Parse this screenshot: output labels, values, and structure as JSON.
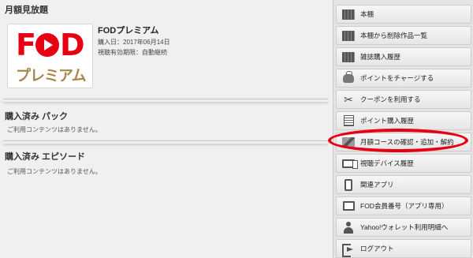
{
  "main": {
    "monthly_title": "月額見放題",
    "product": {
      "name": "FODプレミアム",
      "purchase_date": "購入日：2017年06月14日",
      "validity": "視聴有効期限：自動継続",
      "logo_text_top": "FOD",
      "logo_text_bottom": "プレミアム"
    },
    "pack_title": "購入済み パック",
    "pack_empty": "ご利用コンテンツはありません。",
    "episode_title": "購入済み エピソード",
    "episode_empty": "ご利用コンテンツはありません。"
  },
  "menu": {
    "items": [
      {
        "label": "本棚",
        "icon": "bookshelf-icon"
      },
      {
        "label": "本棚から削除作品一覧",
        "icon": "bookshelf-icon"
      },
      {
        "label": "雑誌購入履歴",
        "icon": "magazine-icon"
      },
      {
        "label": "ポイントをチャージする",
        "icon": "coin-bag-icon"
      },
      {
        "label": "クーポンを利用する",
        "icon": "scissors-icon"
      },
      {
        "label": "ポイント購入履歴",
        "icon": "list-icon"
      },
      {
        "label": "月額コースの確認・追加・解約",
        "icon": "clapper-icon"
      },
      {
        "label": "視聴デバイス履歴",
        "icon": "devices-icon"
      },
      {
        "label": "関連アプリ",
        "icon": "smartphone-icon"
      },
      {
        "label": "FOD会員番号（アプリ専用）",
        "icon": "member-card-icon"
      },
      {
        "label": "Yahoo!ウォレット利用明細へ",
        "icon": "person-icon"
      },
      {
        "label": "ログアウト",
        "icon": "logout-icon"
      }
    ]
  },
  "colors": {
    "brand_red": "#e60012",
    "premium_gold": "#a8884e",
    "highlight": "#e60012"
  }
}
